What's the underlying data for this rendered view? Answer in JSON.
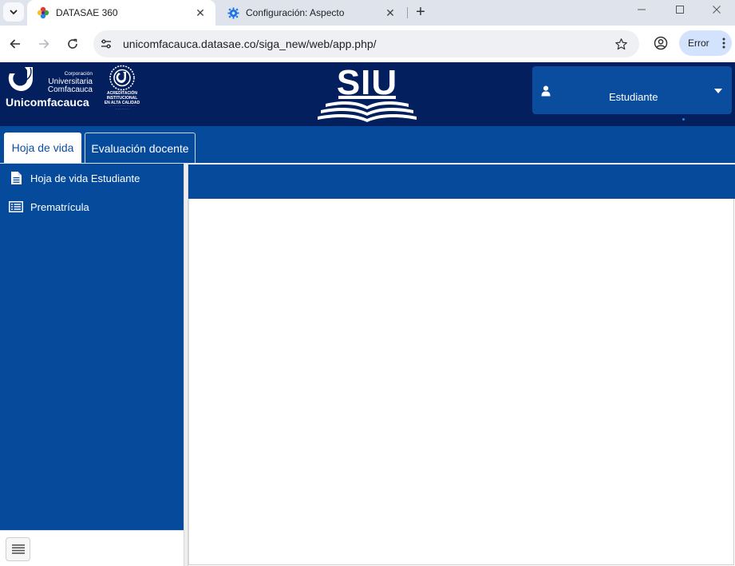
{
  "browser": {
    "tabs": [
      {
        "title": "DATASAE 360",
        "active": true
      },
      {
        "title": "Configuración: Aspecto",
        "active": false
      }
    ],
    "url": "unicomfacauca.datasae.co/siga_new/web/app.php/",
    "error_label": "Error"
  },
  "header": {
    "logo": {
      "corporacion": "Corporación",
      "universitaria": "Universitaria",
      "comfacauca": "Comfacauca",
      "name": "Unicomfacauca"
    },
    "accreditation": {
      "line1": "ACREDITACIÓN",
      "line2": "INSTITUCIONAL",
      "line3": "EN ALTA CALIDAD"
    },
    "brand": "SIU",
    "user_role": "Estudiante"
  },
  "nav": {
    "tabs": [
      {
        "label": "Hoja de vida",
        "active": true
      },
      {
        "label": "Evaluación docente",
        "active": false
      }
    ]
  },
  "sidebar": {
    "items": [
      {
        "label": "Hoja de vida Estudiante",
        "icon": "document-icon"
      },
      {
        "label": "Prematrícula",
        "icon": "list-icon"
      }
    ]
  },
  "colors": {
    "header_bg": "#041f5e",
    "nav_bg": "#054a9b",
    "user_box_bg": "#0a4c9e"
  }
}
